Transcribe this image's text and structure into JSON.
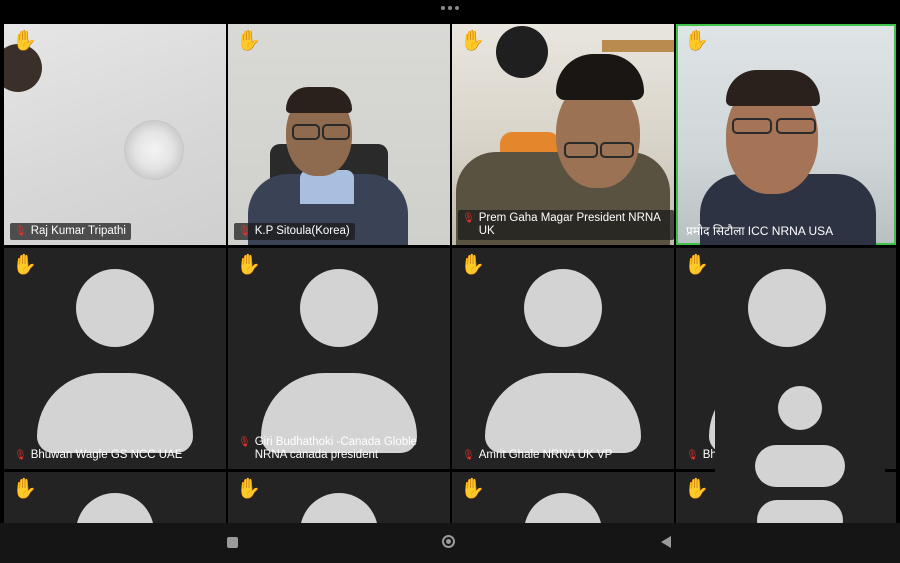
{
  "meeting": {
    "more_icon": "more-dots-icon",
    "raised_hand_icon": "raised-hand-icon",
    "muted_mic_icon": "mic-muted-icon",
    "colors": {
      "active_speaker_border": "#3ec24a",
      "hand": "#f2b531",
      "muted_mic": "#e0342f",
      "tile_bg": "#232323"
    }
  },
  "participants": [
    {
      "name": "Raj Kumar Tripathi",
      "video": true
    },
    {
      "name": "K.P Sitoula(Korea)",
      "video": true
    },
    {
      "name": "Prem Gaha Magar President NRNA UK",
      "video": true
    },
    {
      "name": "प्रमोद सिटौला ICC NRNA USA",
      "video": true,
      "active_speaker": true
    },
    {
      "name": "Bhuwan Wagle GS NCC UAE",
      "video": false
    },
    {
      "name": "Giri Budhathoki -Canada Globle NRNA canada president",
      "video": false
    },
    {
      "name": "Amrit Ghale NRNA UK VP",
      "video": false
    },
    {
      "name": "Bh",
      "video": false
    }
  ],
  "nav": {
    "recent_icon": "square-recents-icon",
    "home_icon": "circle-home-icon",
    "back_icon": "triangle-back-icon"
  }
}
